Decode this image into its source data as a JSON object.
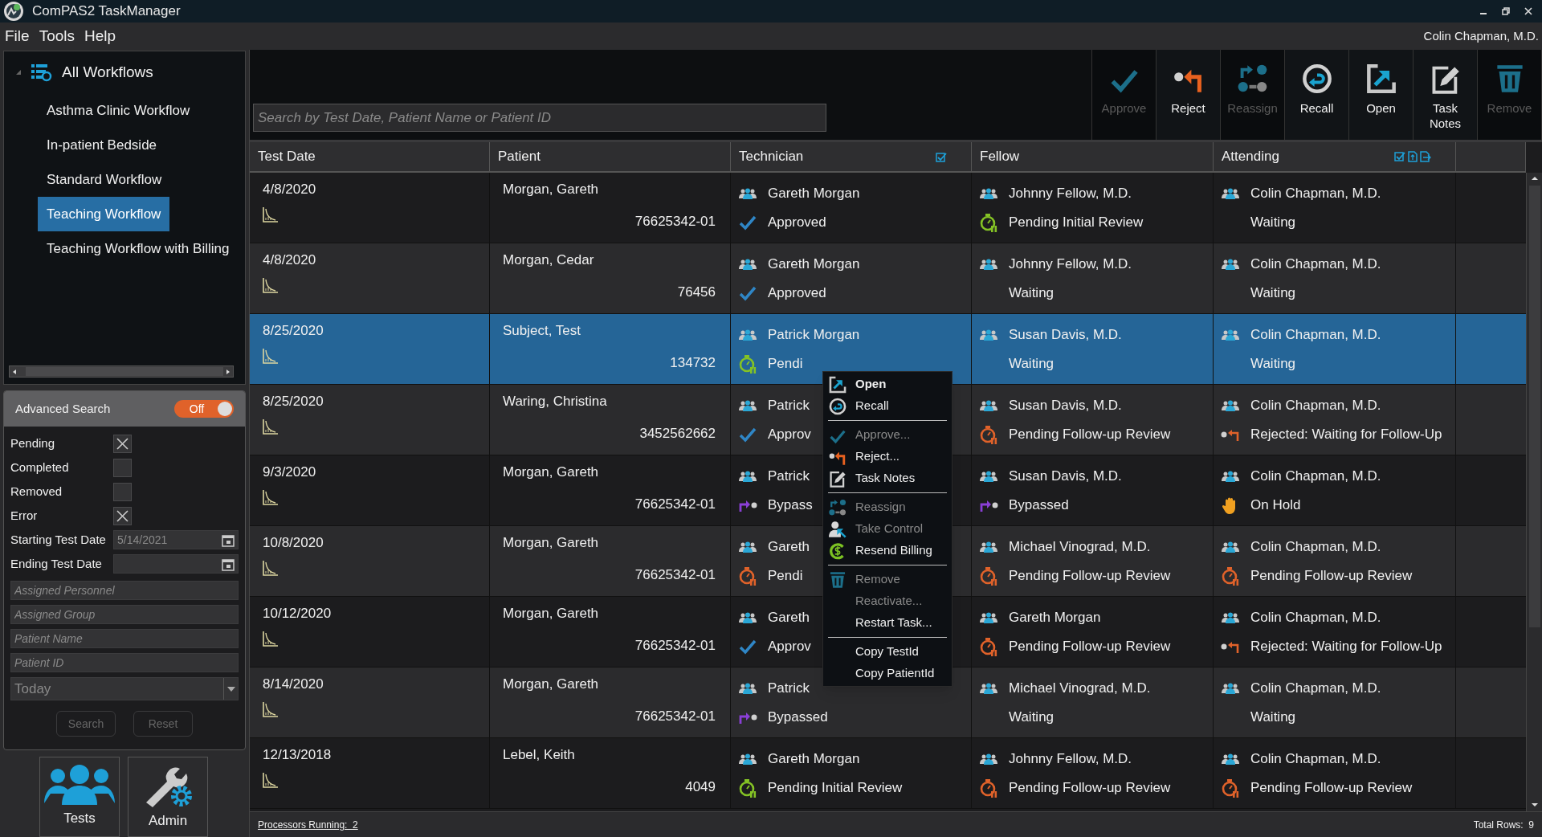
{
  "window": {
    "title": "ComPAS2 TaskManager"
  },
  "menu": [
    "File",
    "Tools",
    "Help"
  ],
  "user": "Colin Chapman, M.D.",
  "sidebar": {
    "root": {
      "label": "All Workflows",
      "expanded": true,
      "children": [
        {
          "label": "Asthma Clinic Workflow",
          "selected": false
        },
        {
          "label": "In-patient Bedside",
          "selected": false
        },
        {
          "label": "Standard Workflow",
          "selected": false
        },
        {
          "label": "Teaching Workflow",
          "selected": true
        },
        {
          "label": "Teaching Workflow with Billing",
          "selected": false
        }
      ]
    }
  },
  "advanced_search": {
    "title": "Advanced Search",
    "toggle": {
      "label": "Off",
      "on": false
    },
    "filters": [
      {
        "label": "Pending",
        "checked": true
      },
      {
        "label": "Completed",
        "checked": false
      },
      {
        "label": "Removed",
        "checked": false
      },
      {
        "label": "Error",
        "checked": true
      }
    ],
    "date_fields": [
      {
        "label": "Starting Test Date",
        "value": "5/14/2021"
      },
      {
        "label": "Ending Test Date"
      }
    ],
    "text_fields": [
      {
        "placeholder": "Assigned Personnel"
      },
      {
        "placeholder": "Assigned Group"
      },
      {
        "placeholder": "Patient Name"
      },
      {
        "placeholder": "Patient ID"
      }
    ],
    "range": {
      "value": "Today"
    },
    "buttons": [
      "Search",
      "Reset"
    ]
  },
  "nav_buttons": [
    {
      "label": "Tests",
      "kind": "people"
    },
    {
      "label": "Admin",
      "kind": "tools"
    }
  ],
  "toolbar": [
    {
      "label": "Approve",
      "kind": "approve",
      "disabled": true
    },
    {
      "label": "Reject",
      "kind": "reject",
      "disabled": false
    },
    {
      "label": "Reassign",
      "kind": "reassign",
      "disabled": true
    },
    {
      "label": "Recall",
      "kind": "recall",
      "disabled": false
    },
    {
      "label": "Open",
      "kind": "open",
      "disabled": false
    },
    {
      "label": "Task Notes",
      "kind": "notes",
      "disabled": false
    },
    {
      "label": "Remove",
      "kind": "remove",
      "disabled": true
    }
  ],
  "search": {
    "placeholder": "Search by Test Date, Patient Name or Patient ID"
  },
  "table": {
    "columns": [
      "Test Date",
      "Patient",
      "Technician",
      "Fellow",
      "Attending"
    ],
    "rows": [
      {
        "selected": false,
        "test_date": "4/8/2020",
        "patient_name": "Morgan, Gareth",
        "patient_id": "76625342-01",
        "technician": {
          "name": "Gareth Morgan",
          "status": "Approved",
          "kind": "approved"
        },
        "fellow": {
          "name": "Johnny Fellow, M.D.",
          "status": "Pending Initial Review",
          "kind": "pending_initial"
        },
        "attending": {
          "name": "Colin Chapman, M.D.",
          "status": "Waiting",
          "kind": "waiting"
        }
      },
      {
        "selected": false,
        "test_date": "4/8/2020",
        "patient_name": "Morgan, Cedar",
        "patient_id": "76456",
        "technician": {
          "name": "Gareth Morgan",
          "status": "Approved",
          "kind": "approved"
        },
        "fellow": {
          "name": "Johnny Fellow, M.D.",
          "status": "Waiting",
          "kind": "waiting"
        },
        "attending": {
          "name": "Colin Chapman, M.D.",
          "status": "Waiting",
          "kind": "waiting"
        }
      },
      {
        "selected": true,
        "test_date": "8/25/2020",
        "patient_name": "Subject, Test",
        "patient_id": "134732",
        "technician": {
          "name": "Patrick Morgan",
          "status": "Pendi",
          "kind": "pending_initial"
        },
        "fellow": {
          "name": "Susan Davis, M.D.",
          "status": "Waiting",
          "kind": "waiting"
        },
        "attending": {
          "name": "Colin Chapman, M.D.",
          "status": "Waiting",
          "kind": "waiting"
        }
      },
      {
        "selected": false,
        "test_date": "8/25/2020",
        "patient_name": "Waring, Christina",
        "patient_id": "3452562662",
        "technician": {
          "name": "Patrick",
          "status": "Approv",
          "kind": "approved"
        },
        "fellow": {
          "name": "Susan Davis, M.D.",
          "status": "Pending Follow-up Review",
          "kind": "pending_followup"
        },
        "attending": {
          "name": "Colin Chapman, M.D.",
          "status": "Rejected: Waiting for Follow-Up",
          "kind": "rejected"
        }
      },
      {
        "selected": false,
        "test_date": "9/3/2020",
        "patient_name": "Morgan, Gareth",
        "patient_id": "76625342-01",
        "technician": {
          "name": "Patrick",
          "status": "Bypass",
          "kind": "bypassed"
        },
        "fellow": {
          "name": "Susan Davis, M.D.",
          "status": "Bypassed",
          "kind": "bypassed"
        },
        "attending": {
          "name": "Colin Chapman, M.D.",
          "status": "On Hold",
          "kind": "hold"
        }
      },
      {
        "selected": false,
        "test_date": "10/8/2020",
        "patient_name": "Morgan, Gareth",
        "patient_id": "76625342-01",
        "technician": {
          "name": "Gareth",
          "status": "Pendi",
          "kind": "pending_followup"
        },
        "fellow": {
          "name": "Michael Vinograd, M.D.",
          "status": "Pending Follow-up Review",
          "kind": "pending_followup"
        },
        "attending": {
          "name": "Colin Chapman, M.D.",
          "status": "Pending Follow-up Review",
          "kind": "pending_followup"
        }
      },
      {
        "selected": false,
        "test_date": "10/12/2020",
        "patient_name": "Morgan, Gareth",
        "patient_id": "76625342-01",
        "technician": {
          "name": "Gareth",
          "status": "Approv",
          "kind": "approved"
        },
        "fellow": {
          "name": "Gareth Morgan",
          "status": "Pending Follow-up Review",
          "kind": "pending_followup"
        },
        "attending": {
          "name": "Colin Chapman, M.D.",
          "status": "Rejected: Waiting for Follow-Up",
          "kind": "rejected"
        }
      },
      {
        "selected": false,
        "test_date": "8/14/2020",
        "patient_name": "Morgan, Gareth",
        "patient_id": "76625342-01",
        "technician": {
          "name": "Patrick",
          "status": "Bypassed",
          "kind": "bypassed"
        },
        "fellow": {
          "name": "Michael Vinograd, M.D.",
          "status": "Waiting",
          "kind": "waiting"
        },
        "attending": {
          "name": "Colin Chapman, M.D.",
          "status": "Waiting",
          "kind": "waiting"
        }
      },
      {
        "selected": false,
        "test_date": "12/13/2018",
        "patient_name": "Lebel, Keith",
        "patient_id": "4049",
        "technician": {
          "name": "Gareth Morgan",
          "status": "Pending Initial Review",
          "kind": "pending_initial"
        },
        "fellow": {
          "name": "Johnny Fellow, M.D.",
          "status": "Pending Follow-up Review",
          "kind": "pending_followup"
        },
        "attending": {
          "name": "Colin Chapman, M.D.",
          "status": "Pending Follow-up Review",
          "kind": "pending_followup"
        }
      }
    ]
  },
  "context_menu": {
    "groups": [
      [
        {
          "label": "Open",
          "kind": "open",
          "disabled": false,
          "default": true
        },
        {
          "label": "Recall",
          "kind": "recall",
          "disabled": false,
          "default": false
        }
      ],
      [
        {
          "label": "Approve...",
          "kind": "approve",
          "disabled": true,
          "default": false
        },
        {
          "label": "Reject...",
          "kind": "reject",
          "disabled": false,
          "default": false
        },
        {
          "label": "Task Notes",
          "kind": "notes",
          "disabled": false,
          "default": false
        }
      ],
      [
        {
          "label": "Reassign",
          "kind": "reassign",
          "disabled": true,
          "default": false
        },
        {
          "label": "Take Control",
          "kind": "take_control",
          "disabled": true,
          "default": false
        },
        {
          "label": "Resend Billing",
          "kind": "billing",
          "disabled": false,
          "default": false
        }
      ],
      [
        {
          "label": "Remove",
          "kind": "remove",
          "disabled": true,
          "default": false
        },
        {
          "label": "Reactivate...",
          "kind": "plain",
          "disabled": true,
          "default": false
        },
        {
          "label": "Restart Task...",
          "kind": "plain",
          "disabled": false,
          "default": false
        }
      ],
      [
        {
          "label": "Copy TestId",
          "kind": "plain",
          "disabled": false,
          "default": false
        },
        {
          "label": "Copy PatientId",
          "kind": "plain",
          "disabled": false,
          "default": false
        }
      ]
    ]
  },
  "status_bar": {
    "processors": "Processors Running:  2",
    "total": "Total Rows:  9"
  }
}
